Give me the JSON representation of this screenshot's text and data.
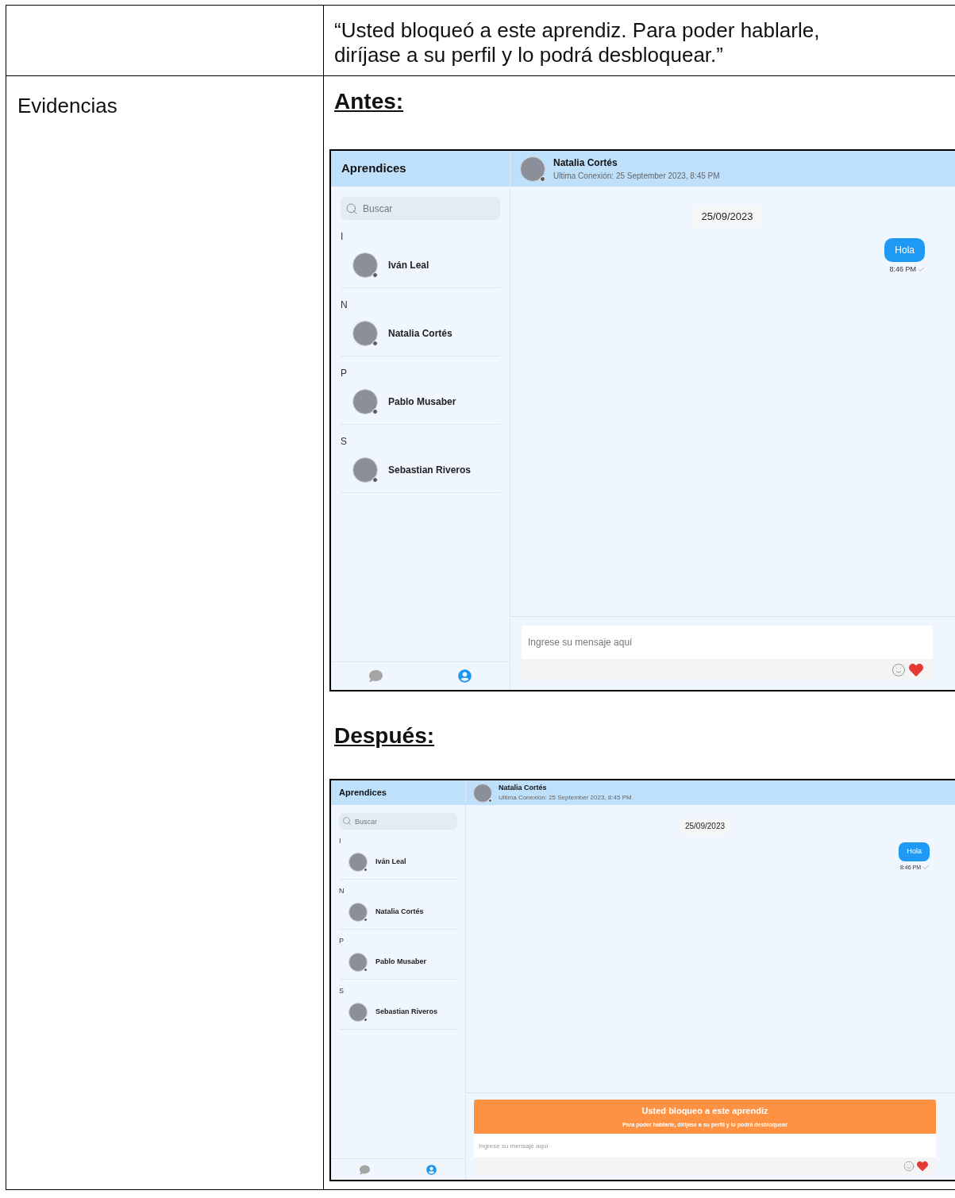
{
  "table": {
    "rows": [
      {
        "label": "",
        "content": "“Usted bloqueó a este aprendiz. Para poder hablarle, diríjase a su perfil y lo podrá desbloquear.”"
      },
      {
        "label": "Evidencias",
        "sections": [
          {
            "heading": "Antes:",
            "kind": "large",
            "app": {
              "sidebar_title": "Aprendices",
              "search": {
                "placeholder": "Buscar"
              },
              "groups": [
                {
                  "letter": "I",
                  "contacts": [
                    "Iván Leal"
                  ]
                },
                {
                  "letter": "N",
                  "contacts": [
                    "Natalia Cortés"
                  ]
                },
                {
                  "letter": "P",
                  "contacts": [
                    "Pablo Musaber"
                  ]
                },
                {
                  "letter": "S",
                  "contacts": [
                    "Sebastian Riveros"
                  ]
                }
              ],
              "nav": [
                {
                  "kind": "chats",
                  "selected": false
                },
                {
                  "kind": "profile",
                  "selected": true
                }
              ],
              "chat": {
                "name": "Natalia Cortés",
                "last_seen": "Ultima Conexión: 25 September 2023, 8:45 PM",
                "date": "25/09/2023",
                "messages": [
                  {
                    "text": "Hola",
                    "time": "8:46 PM"
                  }
                ],
                "input": {
                  "placeholder": "Ingrese su mensaje aquí"
                }
              }
            }
          },
          {
            "heading": "Después:",
            "kind": "small",
            "app": {
              "sidebar_title": "Aprendices",
              "search": {
                "placeholder": "Buscar"
              },
              "groups": [
                {
                  "letter": "I",
                  "contacts": [
                    "Iván Leal"
                  ]
                },
                {
                  "letter": "N",
                  "contacts": [
                    "Natalia Cortés"
                  ]
                },
                {
                  "letter": "P",
                  "contacts": [
                    "Pablo Musaber"
                  ]
                },
                {
                  "letter": "S",
                  "contacts": [
                    "Sebastian Riveros"
                  ]
                }
              ],
              "nav": [
                {
                  "kind": "chats",
                  "selected": false
                },
                {
                  "kind": "profile",
                  "selected": true
                }
              ],
              "chat": {
                "name": "Natalia Cortés",
                "last_seen": "Ultima Conexión: 25 September 2023, 8:45 PM",
                "date": "25/09/2023",
                "messages": [
                  {
                    "text": "Hola",
                    "time": "8:46 PM"
                  }
                ],
                "banner": {
                  "title": "Usted bloqueo a este aprendiz",
                  "subtitle": "Para poder hablarle, dirijase a su perfil y lo podrá desbloquear"
                },
                "input": {
                  "placeholder": "Ingrese su mensaje aquí"
                }
              }
            }
          }
        ]
      }
    ]
  }
}
